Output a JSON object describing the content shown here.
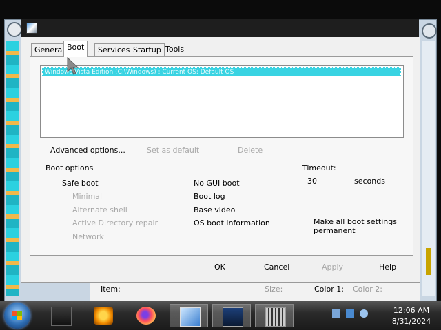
{
  "colors": {
    "selection": "#39d3e2",
    "dialog_bg": "#f0f0f0",
    "titlebar": "#1e1e1e",
    "taskbar": "#1a1a1a",
    "disabled_text": "#a8a8a8"
  },
  "tabs": [
    {
      "label": "General"
    },
    {
      "label": "Boot"
    },
    {
      "label": "Services"
    },
    {
      "label": "Startup"
    },
    {
      "label": "Tools"
    }
  ],
  "active_tab": "Boot",
  "boot_list": {
    "entries": [
      "Windows Vista Edition (C:\\Windows) : Current OS; Default OS"
    ]
  },
  "actions": {
    "advanced": "Advanced options...",
    "set_default": "Set as default",
    "delete": "Delete"
  },
  "boot_options": {
    "heading": "Boot options",
    "safe_boot": "Safe boot",
    "minimal": "Minimal",
    "alternate_shell": "Alternate shell",
    "ad_repair": "Active Directory repair",
    "network": "Network",
    "no_gui": "No GUI boot",
    "boot_log": "Boot log",
    "base_video": "Base video",
    "os_info": "OS boot information"
  },
  "timeout": {
    "label": "Timeout:",
    "value": "30",
    "unit": "seconds"
  },
  "permanent_line1": "Make all boot settings",
  "permanent_line2": "permanent",
  "buttons": {
    "ok": "OK",
    "cancel": "Cancel",
    "apply": "Apply",
    "help": "Help"
  },
  "background_panel": {
    "item": "Item:",
    "size": "Size:",
    "color1": "Color 1:",
    "color2": "Color 2:"
  },
  "taskbar": {
    "icons": [
      "media-player-icon",
      "windows-media-center-icon",
      "firefox-icon",
      "control-panel-icon",
      "task-manager-icon",
      "keyboard-icon"
    ],
    "clock_time": "12:06 AM",
    "clock_date": "8/31/2024"
  }
}
